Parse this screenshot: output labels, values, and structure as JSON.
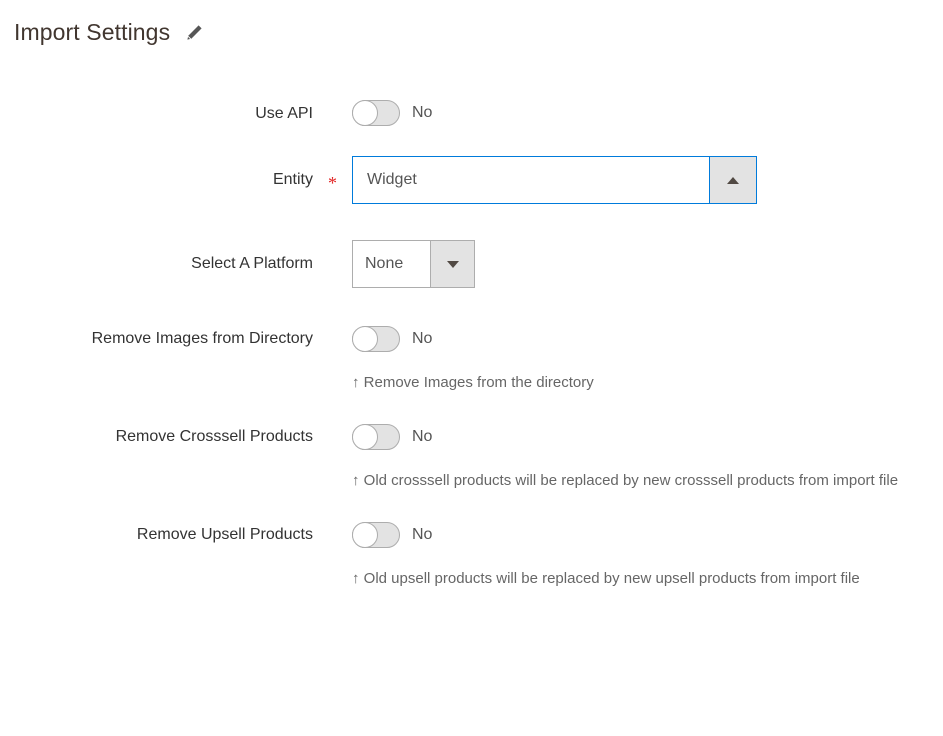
{
  "header": {
    "title": "Import Settings",
    "edit_icon": "pencil-icon"
  },
  "form": {
    "fields": [
      {
        "label": "Use API",
        "type": "toggle",
        "required": false,
        "value": "No",
        "note": ""
      },
      {
        "label": "Entity",
        "type": "combobox",
        "required": true,
        "required_marker": "*",
        "value": "Widget",
        "placeholder": "",
        "button_icon": "chevron-up-icon",
        "note": ""
      },
      {
        "label": "Select A Platform",
        "type": "select",
        "required": false,
        "value": "None",
        "button_icon": "chevron-down-icon",
        "note": ""
      },
      {
        "label": "Remove Images from Directory",
        "type": "toggle",
        "required": false,
        "value": "No",
        "note": "↑ Remove Images from the directory"
      },
      {
        "label": "Remove Crosssell Products",
        "type": "toggle",
        "required": false,
        "value": "No",
        "note": "↑ Old crosssell products will be replaced by new crosssell products from import file"
      },
      {
        "label": "Remove Upsell Products",
        "type": "toggle",
        "required": false,
        "value": "No",
        "note": "↑ Old upsell products will be replaced by new upsell products from import file"
      }
    ]
  },
  "colors": {
    "focus_border": "#007bdb",
    "required_star": "#e22626",
    "toggle_track": "#e3e3e3",
    "toggle_border": "#adadad",
    "button_face": "#e3e3e3",
    "title_text": "#41362f",
    "note_text": "#666666"
  }
}
